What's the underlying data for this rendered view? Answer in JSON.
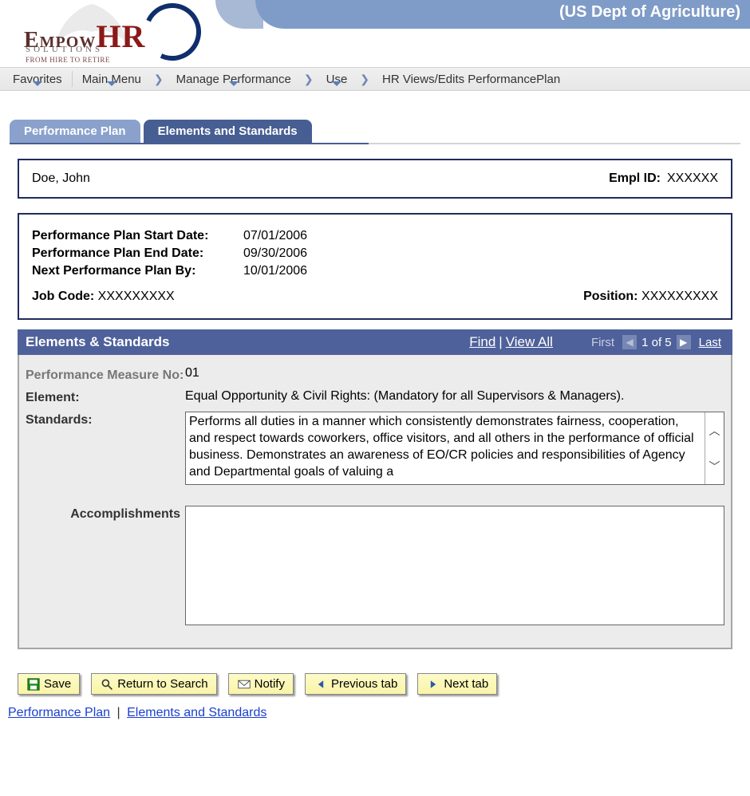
{
  "header": {
    "org": "(US Dept of Agriculture)"
  },
  "logo": {
    "brand1": "Empow",
    "brand2": "HR",
    "sub": "SOLUTIONS",
    "tag": "FROM HIRE TO RETIRE"
  },
  "breadcrumb": {
    "favorites": "Favorites",
    "main_menu": "Main Menu",
    "manage": "Manage Performance",
    "use": "Use",
    "current": "HR Views/Edits PerformancePlan"
  },
  "tabs": {
    "performance_plan": "Performance Plan",
    "elements_standards": "Elements and Standards"
  },
  "employee": {
    "name": "Doe, John",
    "empid_label": "Empl ID:",
    "empid_value": "XXXXXX"
  },
  "plan": {
    "start_label": "Performance Plan Start Date:",
    "start_value": "07/01/2006",
    "end_label": "Performance Plan End Date:",
    "end_value": "09/30/2006",
    "next_label": "Next Performance Plan By:",
    "next_value": "10/01/2006",
    "jobcode_label": "Job Code:",
    "jobcode_value": "XXXXXXXXX",
    "position_label": "Position:",
    "position_value": "XXXXXXXXX"
  },
  "section": {
    "title": "Elements & Standards",
    "find": "Find",
    "viewall": "View All",
    "first": "First",
    "pager": "1 of 5",
    "last": "Last"
  },
  "form": {
    "measure_label": "Performance Measure No:",
    "measure_value": "01",
    "element_label": "Element:",
    "element_value": "Equal Opportunity & Civil Rights: (Mandatory for all Supervisors & Managers).",
    "standards_label": "Standards:",
    "standards_value": "Performs all duties in a manner which consistently demonstrates fairness, cooperation, and respect towards coworkers, office visitors, and all others in the performance of official business. Demonstrates an awareness of EO/CR policies and responsibilities of Agency and Departmental goals of valuing a",
    "accomp_label": "Accomplishments",
    "accomp_value": ""
  },
  "buttons": {
    "save": "Save",
    "return": "Return to Search",
    "notify": "Notify",
    "prev": "Previous tab",
    "next": "Next tab"
  },
  "bottom_links": {
    "performance_plan": "Performance Plan",
    "elements_standards": "Elements and Standards"
  }
}
